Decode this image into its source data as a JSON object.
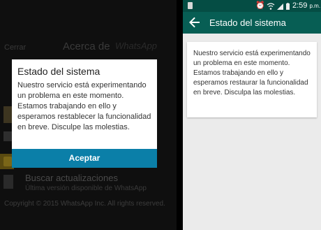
{
  "left": {
    "background": {
      "close_label": "Cerrar",
      "title": "Acerca de",
      "logo_text": "WhatsApp",
      "update_title": "Buscar actualizaciones",
      "update_subtitle": "Última versión disponible de WhatsApp",
      "copyright": "Copyright © 2015 WhatsApp Inc. All rights reserved."
    },
    "dialog": {
      "title": "Estado del sistema",
      "message": "Nuestro servicio está experimentando un problema en este momento. Estamos trabajando en ello y esperamos restablecer la funcionalidad en breve. Disculpe las molestias.",
      "button_label": "Aceptar"
    }
  },
  "right": {
    "status_bar": {
      "time": "2:59",
      "ampm": "p.m.",
      "icons": [
        "notification-icon",
        "alarm-icon",
        "wifi-icon",
        "signal-icon",
        "battery-icon"
      ]
    },
    "toolbar": {
      "back_icon": "arrow-back-icon",
      "title": "Estado del sistema"
    },
    "card": {
      "message": "Nuestro servicio está experimentando un problema en este momento. Estamos trabajando en ello y esperamos restaurar la funcionalidad en breve. Disculpa las molestias."
    }
  },
  "colors": {
    "whatsapp_dark_green": "#075e54",
    "status_bar_green": "#054d44",
    "button_blue": "#0b7fa8",
    "background_gray": "#ebebeb"
  }
}
